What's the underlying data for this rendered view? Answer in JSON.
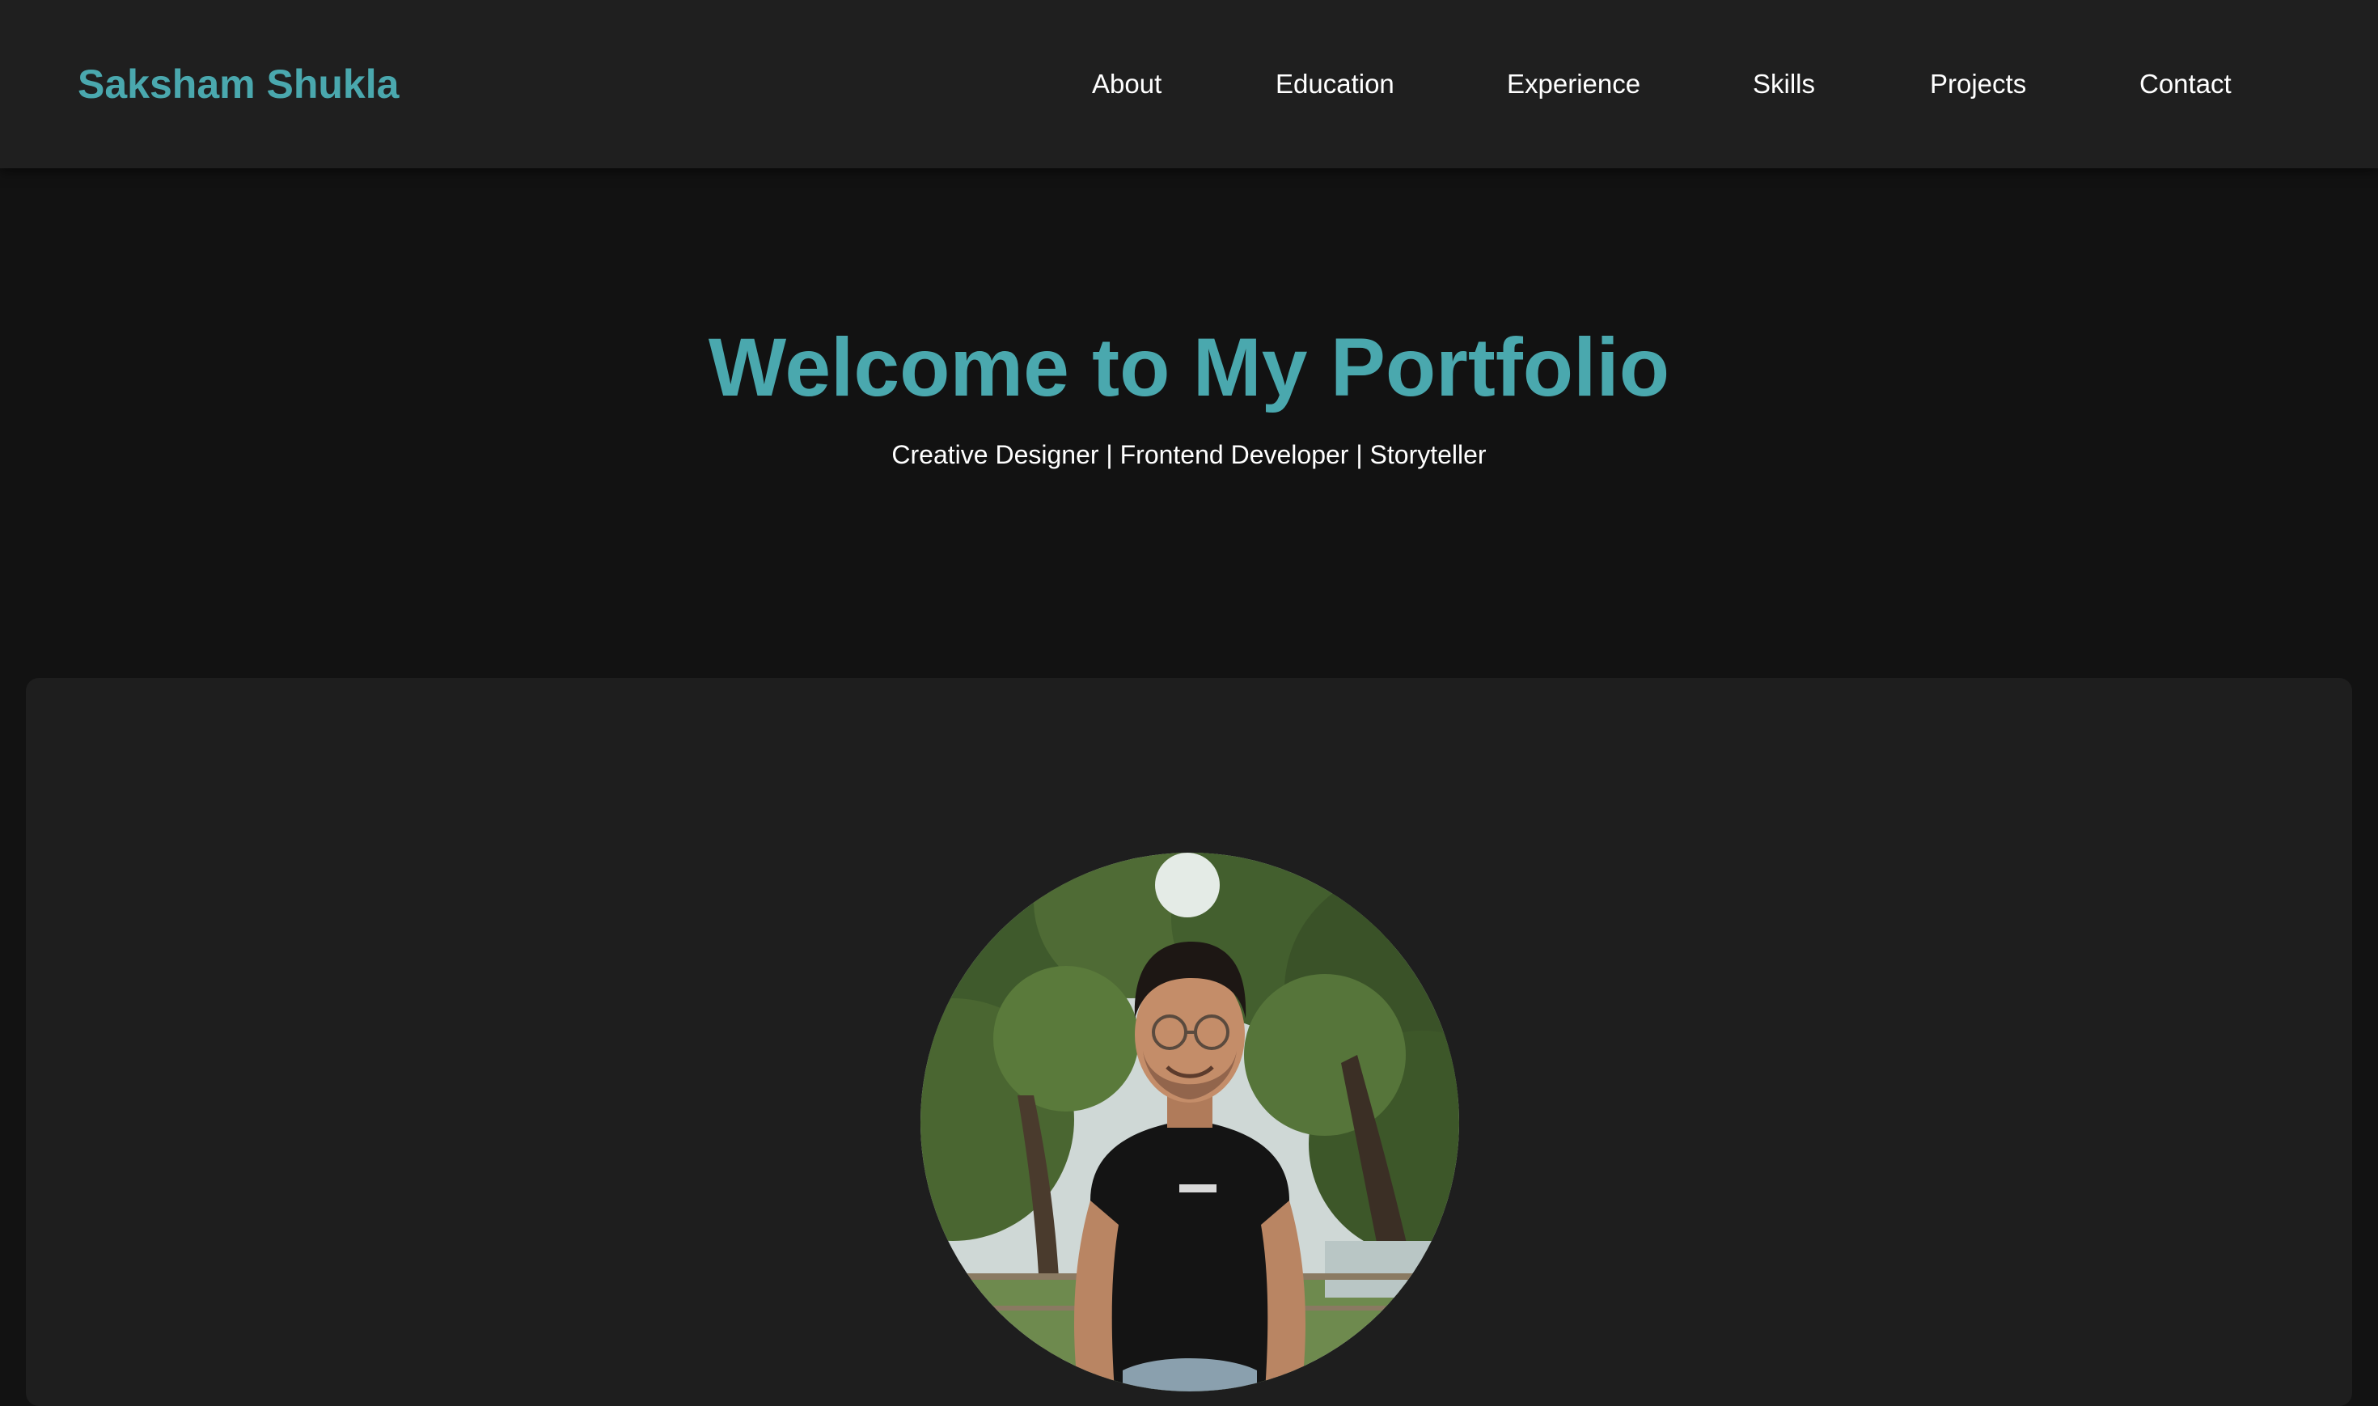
{
  "header": {
    "brand": "Saksham Shukla",
    "nav": [
      {
        "label": "About"
      },
      {
        "label": "Education"
      },
      {
        "label": "Experience"
      },
      {
        "label": "Skills"
      },
      {
        "label": "Projects"
      },
      {
        "label": "Contact"
      }
    ]
  },
  "hero": {
    "title": "Welcome to My Portfolio",
    "subtitle": "Creative Designer | Frontend Developer | Storyteller"
  },
  "about": {
    "photo_icon": "profile-photo"
  },
  "colors": {
    "accent": "#4aa8ae",
    "background": "#121212",
    "surface": "#1f1f1f",
    "text": "#ffffff"
  }
}
